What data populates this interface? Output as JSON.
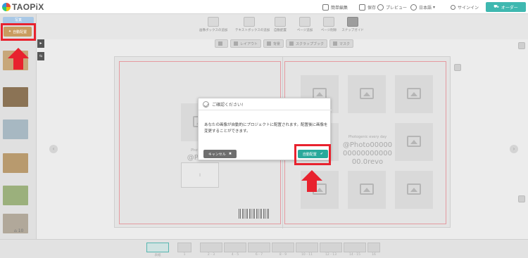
{
  "header": {
    "logo_text": "TAOPiX",
    "items": [
      {
        "label": "簡単編集"
      },
      {
        "label": "保存"
      },
      {
        "label": "プレビュー"
      },
      {
        "label": "日本語"
      },
      {
        "label": "サインイン"
      }
    ],
    "order_label": "オーダー"
  },
  "toolbar": {
    "tools": [
      {
        "label": "画像ボックスの追加"
      },
      {
        "label": "テキストボックスの追加"
      },
      {
        "label": "自動配置"
      },
      {
        "label": "ページ追加"
      },
      {
        "label": "ページ削除"
      },
      {
        "label": "スナップガイド"
      }
    ]
  },
  "subnav": {
    "items": [
      {
        "label": "レイアウト"
      },
      {
        "label": "背景"
      },
      {
        "label": "スクラップブック"
      },
      {
        "label": "マスク"
      }
    ]
  },
  "left_panel": {
    "top_button": "写真",
    "auto_button": "自動配置",
    "photo_count": "10",
    "thumbnails": [
      {
        "color": "#c7a77a"
      },
      {
        "color": "#8b7355"
      },
      {
        "color": "#a7b8c2"
      },
      {
        "color": "#b89a6e"
      },
      {
        "color": "#9bb07c"
      },
      {
        "color": "#b1a89a"
      }
    ]
  },
  "canvas": {
    "left_page": {
      "placeholder_small": "Photogenic",
      "placeholder_large": "@Photo",
      "frame_label": "I"
    },
    "right_page": {
      "placeholder_small": "Photogenic every day",
      "placeholder_large": "@Photo000000000000000000.0revo"
    }
  },
  "modal": {
    "title": "ご確認ください!",
    "body": "あなたの画像が自動的にプロジェクトに配置されます。配置後に画像を変更することができます。",
    "cancel_label": "キャンセル",
    "auto_label": "自動配置"
  },
  "pagestrip": {
    "pages": [
      {
        "label": "表紙",
        "active": true
      },
      {
        "label": "1",
        "active": false
      },
      {
        "label": "2 - 3",
        "active": false
      },
      {
        "label": "4 - 5",
        "active": false
      },
      {
        "label": "6 - 7",
        "active": false
      },
      {
        "label": "8 - 9",
        "active": false
      },
      {
        "label": "10 - 11",
        "active": false
      },
      {
        "label": "12 - 13",
        "active": false
      },
      {
        "label": "14 - 15",
        "active": false
      },
      {
        "label": "16",
        "active": false
      }
    ]
  },
  "colors": {
    "accent": "#29a99b",
    "highlight": "#e8222e",
    "order": "#3fb8b0",
    "auto_button": "#c99c5f"
  }
}
